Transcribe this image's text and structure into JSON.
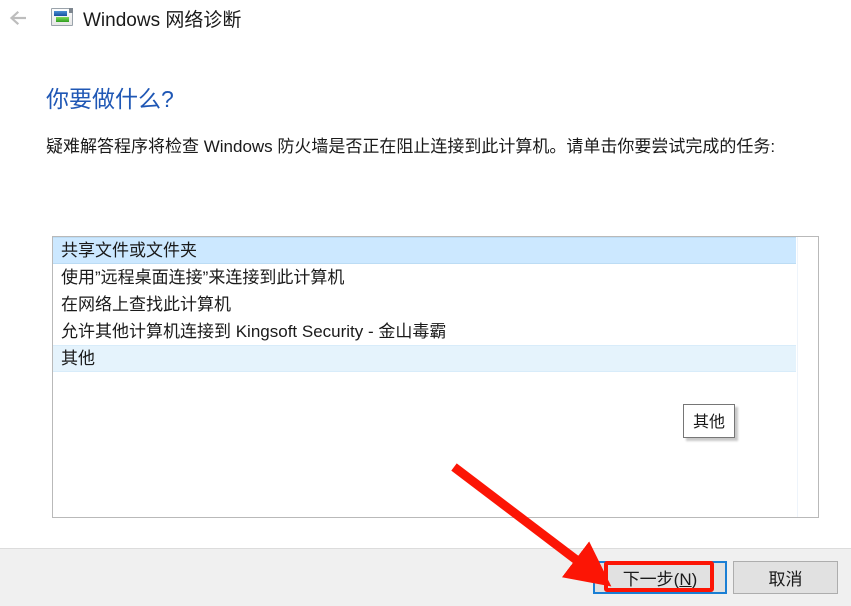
{
  "window": {
    "title": "Windows 网络诊断",
    "back_label": "返回",
    "icon": "network-diagnostic-icon"
  },
  "main": {
    "heading": "你要做什么?",
    "body": "疑难解答程序将检查 Windows 防火墙是否正在阻止连接到此计算机。请单击你要尝试完成的任务:"
  },
  "listbox": {
    "items": [
      {
        "label": "共享文件或文件夹",
        "state": "selected"
      },
      {
        "label": "使用”远程桌面连接”来连接到此计算机",
        "state": "normal"
      },
      {
        "label": "在网络上查找此计算机",
        "state": "normal"
      },
      {
        "label": "允许其他计算机连接到 Kingsoft Security - 金山毒霸",
        "state": "normal"
      },
      {
        "label": "其他",
        "state": "hovered"
      }
    ]
  },
  "tooltip": {
    "text": "其他"
  },
  "footer": {
    "next_label": "下一步(N)",
    "next_accesskey": "N",
    "cancel_label": "取消"
  },
  "annotations": {
    "arrow_color": "#fc1505",
    "rect_color": "#fc1505",
    "focus_color": "#1b7fd4"
  }
}
